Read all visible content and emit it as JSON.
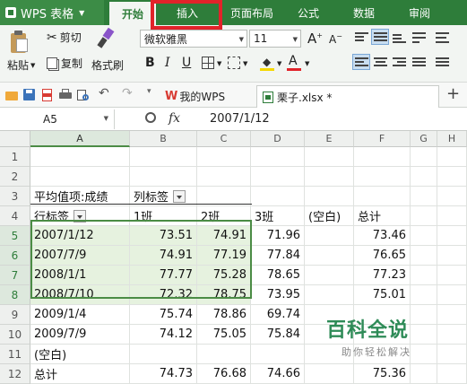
{
  "app": {
    "title": "WPS 表格"
  },
  "ribbon_tabs": [
    "开始",
    "插入",
    "页面布局",
    "公式",
    "数据",
    "审阅"
  ],
  "ribbon": {
    "paste": "粘贴",
    "cut": "剪切",
    "copy": "复制",
    "format_painter": "格式刷",
    "font_name": "微软雅黑",
    "font_size": "11",
    "bold": "B",
    "italic": "I",
    "underline": "U"
  },
  "doc_tabs": [
    {
      "label": "我的WPS"
    },
    {
      "label": "栗子.xlsx *"
    }
  ],
  "formula_bar": {
    "cell_ref": "A5",
    "fx": "fx",
    "value": "2007/1/12"
  },
  "columns": [
    "A",
    "B",
    "C",
    "D",
    "E",
    "F",
    "G",
    "H"
  ],
  "rows": [
    "1",
    "2",
    "3",
    "4",
    "5",
    "6",
    "7",
    "8",
    "9",
    "10",
    "11",
    "12"
  ],
  "pivot": {
    "value_label": "平均值项:成绩",
    "col_label": "列标签",
    "row_label": "行标签",
    "headers": [
      "1班",
      "2班",
      "3班",
      "(空白)",
      "总计"
    ],
    "data": [
      [
        "2007/1/12",
        "73.51",
        "74.91",
        "71.96",
        "",
        "73.46"
      ],
      [
        "2007/7/9",
        "74.91",
        "77.19",
        "77.84",
        "",
        "76.65"
      ],
      [
        "2008/1/1",
        "77.77",
        "75.28",
        "78.65",
        "",
        "77.23"
      ],
      [
        "2008/7/10",
        "72.32",
        "78.75",
        "73.95",
        "",
        "75.01"
      ],
      [
        "2009/1/4",
        "75.74",
        "78.86",
        "69.74",
        "",
        ""
      ],
      [
        "2009/7/9",
        "74.12",
        "75.05",
        "75.84",
        "",
        ""
      ],
      [
        "(空白)",
        "",
        "",
        "",
        "",
        ""
      ],
      [
        "总计",
        "74.73",
        "76.68",
        "74.66",
        "",
        "75.36"
      ]
    ]
  },
  "watermark": {
    "title": "百科全说",
    "subtitle": "助你轻松解决"
  },
  "colors": {
    "brand": "#2e7d3a",
    "highlight": "#e1232a",
    "selection": "#4b8c45"
  }
}
